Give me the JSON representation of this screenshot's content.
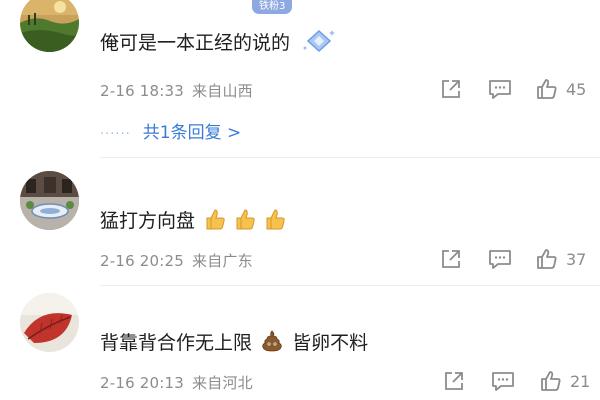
{
  "colors": {
    "link": "#3b7bd8",
    "meta": "#8c8c8c",
    "text": "#1f1f1f",
    "badge": "#8ea9e2"
  },
  "comments": [
    {
      "text": "俺可是一本正经的说的",
      "badge": "铁粉3",
      "time": "2-16 18:33",
      "location": "来自山西",
      "likes": "45",
      "replies_label": "共1条回复 >",
      "replies_dots": "······",
      "avatar_icon": "landscape-avatar"
    },
    {
      "text": "猛打方向盘",
      "emoji": [
        "thumbs-up-emoji",
        "thumbs-up-emoji",
        "thumbs-up-emoji"
      ],
      "time": "2-16 20:25",
      "location": "来自广东",
      "likes": "37",
      "avatar_icon": "courtyard-avatar"
    },
    {
      "text": "背靠背合作无上限",
      "text_suffix": "皆卵不料",
      "emoji": [
        "poop-emoji"
      ],
      "time": "2-16 20:13",
      "location": "来自河北",
      "likes": "21",
      "avatar_icon": "leaf-avatar"
    }
  ]
}
